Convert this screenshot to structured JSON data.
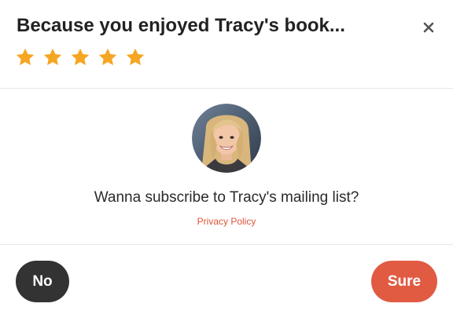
{
  "modal": {
    "title": "Because you enjoyed Tracy's book...",
    "close_icon": "close-icon",
    "rating": 5,
    "rating_max": 5,
    "star_color": "#f5a623"
  },
  "body": {
    "avatar_icon": "author-avatar",
    "prompt": "Wanna subscribe to Tracy's mailing list?",
    "privacy_link": "Privacy Policy"
  },
  "actions": {
    "no_label": "No",
    "sure_label": "Sure",
    "no_color": "#333333",
    "sure_color": "#e15b43",
    "accent_color": "#e0533a"
  }
}
